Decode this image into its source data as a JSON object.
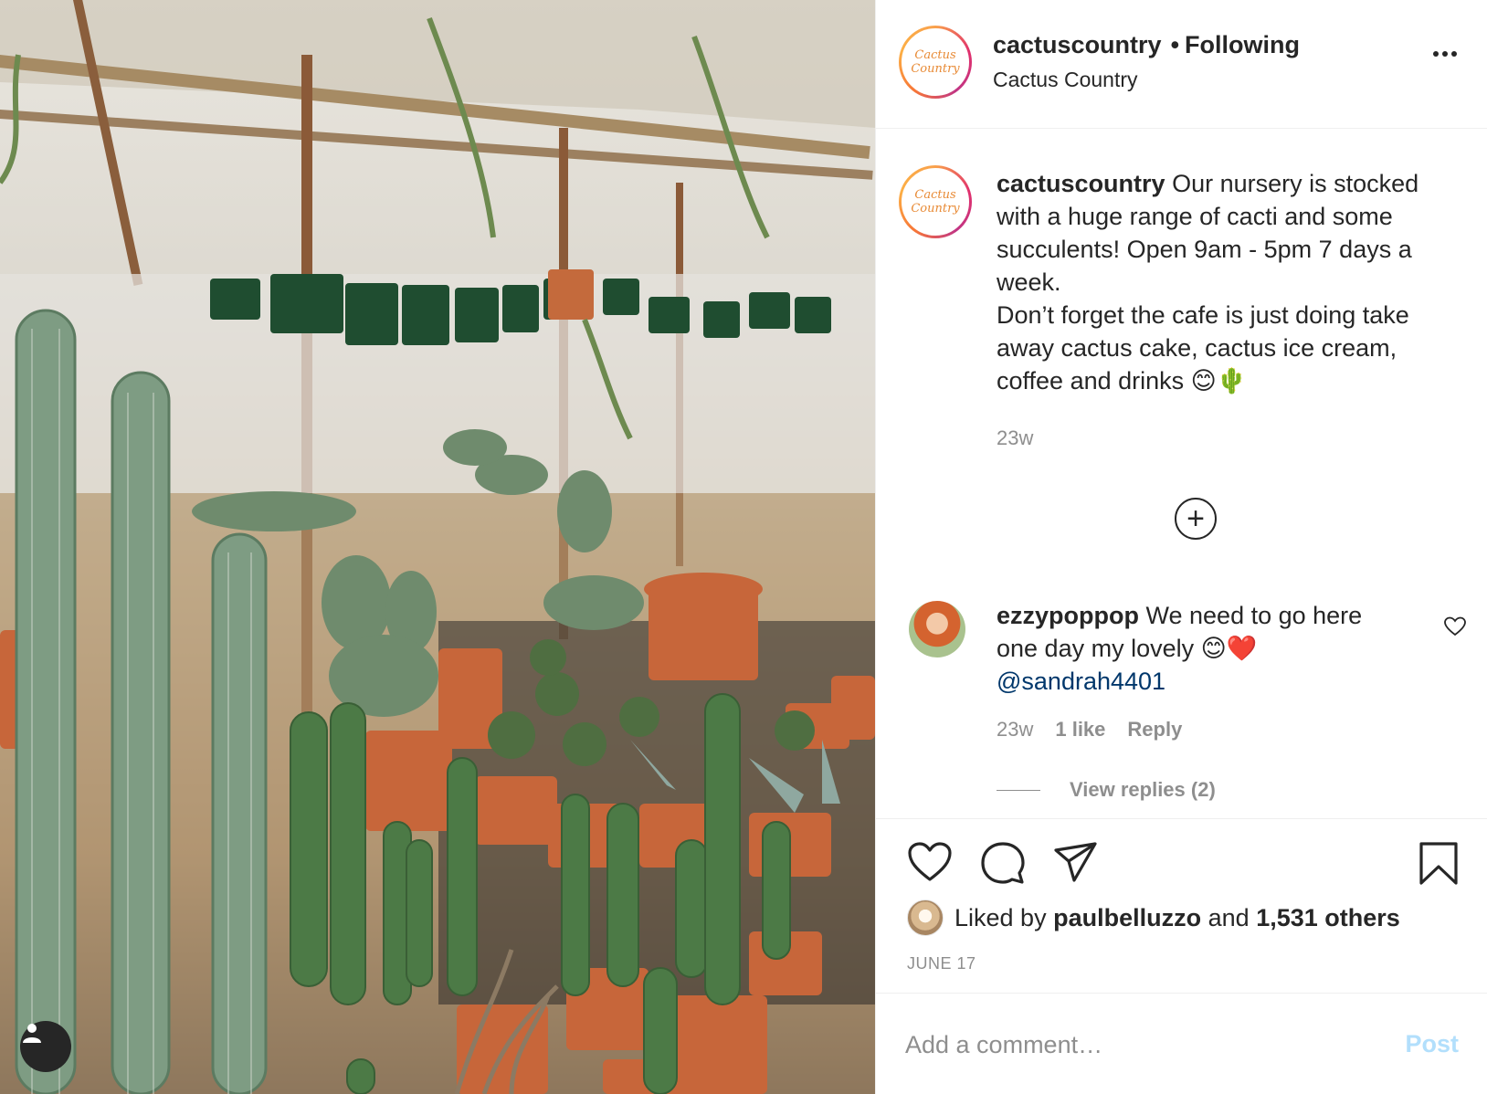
{
  "post": {
    "username": "cactuscountry",
    "follow_dot": "•",
    "follow_status": "Following",
    "location": "Cactus Country",
    "avatar_text_line1": "Cactus",
    "avatar_text_line2": "Country",
    "caption_line1": "Our nursery is stocked with a huge range of cacti and some succulents! Open 9am - 5pm 7 days a week.",
    "caption_line2": "Don’t forget the cafe is just doing take away cactus cake, cactus ice cream, coffee and drinks 😊🌵",
    "caption_time": "23w",
    "likes_prefix": "Liked by",
    "liked_by": "paulbelluzzo",
    "likes_and": "and",
    "likes_others": "1,531 others",
    "date": "JUNE 17"
  },
  "comment": {
    "username": "ezzypoppop",
    "text": "We need to go here one day my lovely 😊❤️",
    "mention": "@sandrah4401",
    "time": "23w",
    "likes": "1 like",
    "reply_label": "Reply",
    "view_replies": "View replies (2)"
  },
  "comment_box": {
    "placeholder": "Add a comment…",
    "post_label": "Post"
  },
  "icons": {
    "more": "more-options-icon",
    "load_more": "plus-circle-icon",
    "heart": "heart-icon",
    "comment": "comment-icon",
    "share": "share-icon",
    "bookmark": "bookmark-icon",
    "user_tag": "user-tag-icon"
  },
  "colors": {
    "text": "#262626",
    "secondary": "#8e8e8e",
    "mention": "#00376b",
    "post_button_disabled": "#b2dffc",
    "divider": "#efefef"
  }
}
